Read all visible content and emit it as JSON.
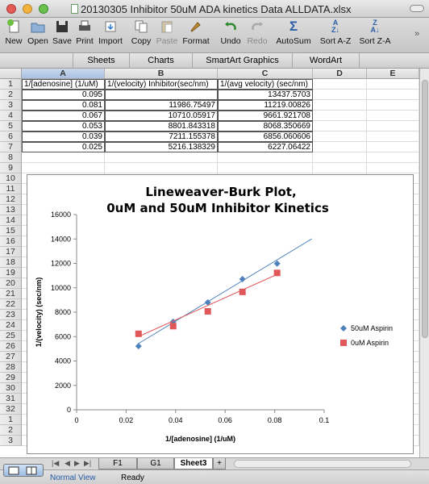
{
  "window": {
    "title": "20130305 Inhibitor 50uM ADA kinetics Data ALLDATA.xlsx"
  },
  "toolbar": {
    "buttons": [
      {
        "label": "New",
        "icon": "new-document-icon"
      },
      {
        "label": "Open",
        "icon": "open-folder-icon"
      },
      {
        "label": "Save",
        "icon": "save-disk-icon"
      },
      {
        "label": "Print",
        "icon": "printer-icon"
      },
      {
        "label": "Import",
        "icon": "import-icon"
      },
      {
        "label": "Copy",
        "icon": "copy-icon"
      },
      {
        "label": "Paste",
        "icon": "paste-icon"
      },
      {
        "label": "Format",
        "icon": "format-brush-icon"
      },
      {
        "label": "Undo",
        "icon": "undo-icon"
      },
      {
        "label": "Redo",
        "icon": "redo-icon"
      },
      {
        "label": "AutoSum",
        "icon": "sigma-icon"
      },
      {
        "label": "Sort A-Z",
        "icon": "sort-ascending-icon"
      },
      {
        "label": "Sort Z-A",
        "icon": "sort-descending-icon"
      }
    ]
  },
  "ribbon": {
    "tabs": [
      "Sheets",
      "Charts",
      "SmartArt Graphics",
      "WordArt"
    ]
  },
  "sheet": {
    "columns": [
      "A",
      "B",
      "C",
      "D",
      "E"
    ],
    "rows": [
      "1",
      "2",
      "3",
      "4",
      "5",
      "6",
      "7",
      "8",
      "9",
      "10",
      "11",
      "12",
      "13",
      "14",
      "15",
      "16",
      "17",
      "18",
      "19",
      "20",
      "21",
      "22",
      "23",
      "24",
      "25",
      "26",
      "27",
      "28",
      "29",
      "30",
      "31",
      "32",
      "1",
      "2",
      "3"
    ],
    "header_row": [
      "1/[adenosine] (1/uM)",
      "1/(velocity) Inhibitor(sec/nm)",
      "1/(avg velocity) (sec/nm)"
    ],
    "data_rows": [
      [
        "0.095",
        "",
        "13437.5703"
      ],
      [
        "0.081",
        "11986.75497",
        "11219.00826"
      ],
      [
        "0.067",
        "10710.05917",
        "9661.921708"
      ],
      [
        "0.053",
        "8801.843318",
        "8068.350669"
      ],
      [
        "0.039",
        "7211.155378",
        "6856.060606"
      ],
      [
        "0.025",
        "5216.138329",
        "6227.06422"
      ]
    ]
  },
  "chart_data": {
    "type": "scatter",
    "title": "Lineweaver-Burk Plot,",
    "subtitle": "0uM and 50uM Inhibitor Kinetics",
    "xlabel": "1/[adenosine] (1/uM)",
    "ylabel": "1/(velocity) (sec/nm)",
    "xlim": [
      0,
      0.1
    ],
    "ylim": [
      0,
      16000
    ],
    "xticks": [
      "0",
      "0.02",
      "0.04",
      "0.06",
      "0.08",
      "0.1"
    ],
    "yticks": [
      "0",
      "2000",
      "4000",
      "6000",
      "8000",
      "10000",
      "12000",
      "14000",
      "16000"
    ],
    "legend_position": "right",
    "series": [
      {
        "name": "50uM Aspirin",
        "marker": "diamond",
        "color": "#4f81bd",
        "x": [
          0.081,
          0.067,
          0.053,
          0.039,
          0.025
        ],
        "y": [
          11986.75497,
          10710.05917,
          8801.843318,
          7211.155378,
          5216.138329
        ],
        "trendline": {
          "x": [
            0.025,
            0.095
          ],
          "y": [
            5430,
            14010
          ]
        }
      },
      {
        "name": "0uM Aspirin",
        "marker": "square",
        "color": "#e0575a",
        "x": [
          0.081,
          0.067,
          0.053,
          0.039,
          0.025
        ],
        "y": [
          11219.00826,
          9661.921708,
          8068.350669,
          6856.060606,
          6227.06422
        ],
        "trendline": {
          "x": [
            0.025,
            0.081
          ],
          "y": [
            6000,
            11100
          ]
        }
      }
    ]
  },
  "sheet_tabs": [
    "F1",
    "G1",
    "Sheet3"
  ],
  "sheet_tab_add": "+",
  "status": {
    "view": "Normal View",
    "ready": "Ready"
  }
}
